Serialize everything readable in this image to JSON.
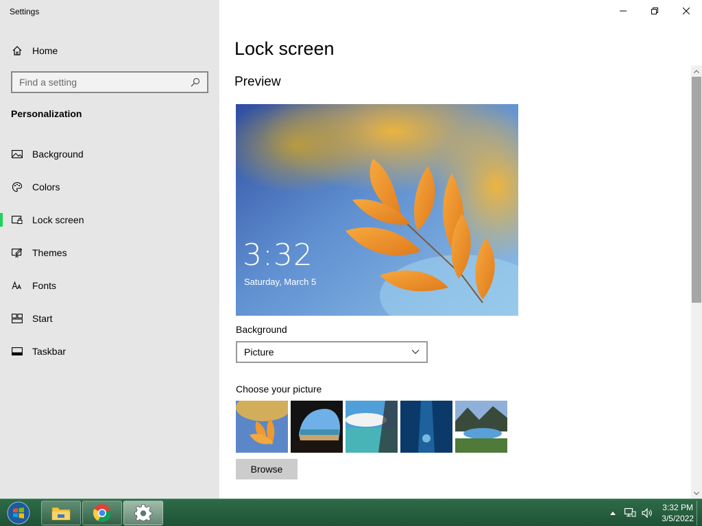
{
  "window": {
    "title": "Settings"
  },
  "sidebar": {
    "home_label": "Home",
    "search_placeholder": "Find a setting",
    "section_title": "Personalization",
    "items": [
      {
        "label": "Background",
        "icon": "picture-icon"
      },
      {
        "label": "Colors",
        "icon": "palette-icon"
      },
      {
        "label": "Lock screen",
        "icon": "lock-screen-icon",
        "active": true
      },
      {
        "label": "Themes",
        "icon": "themes-icon"
      },
      {
        "label": "Fonts",
        "icon": "fonts-icon"
      },
      {
        "label": "Start",
        "icon": "start-icon"
      },
      {
        "label": "Taskbar",
        "icon": "taskbar-icon"
      }
    ]
  },
  "main": {
    "title": "Lock screen",
    "preview_title": "Preview",
    "preview_time": "3:32",
    "preview_date": "Saturday, March 5",
    "background_label": "Background",
    "background_value": "Picture",
    "choose_label": "Choose your picture",
    "browse_label": "Browse"
  },
  "taskbar": {
    "time": "3:32 PM",
    "date": "3/5/2022"
  },
  "colors": {
    "accent": "#1ed35a",
    "sidebar_bg": "#e6e6e6",
    "taskbar_bg": "#2e6b47"
  }
}
